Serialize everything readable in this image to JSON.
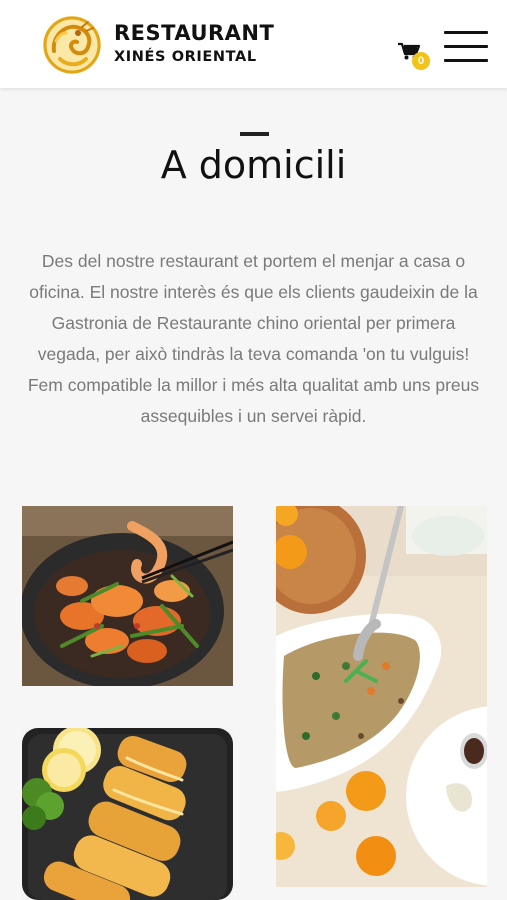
{
  "header": {
    "brand_line1": "RESTAURANT",
    "brand_line2": "XINÉS ORIENTAL",
    "logo_icon": "dragon-logo-icon",
    "cart_icon": "shopping-cart-icon",
    "cart_count": "0",
    "menu_icon": "hamburger-menu-icon"
  },
  "main": {
    "title": "A domicili",
    "intro": "Des del nostre restaurant et portem el menjar a casa o oficina. El nostre interès és que els clients gaudeixin de la Gastronia de Restaurante chino oriental per primera vegada, per això tindràs la teva comanda 'on tu vulguis! Fem compatible la millor i més alta qualitat amb uns preus assequibles i un servei ràpid.",
    "gallery": [
      {
        "subject": "shrimp-stir-fry-photo"
      },
      {
        "subject": "fried-rice-plate-photo"
      },
      {
        "subject": "lemon-chicken-photo"
      }
    ]
  },
  "colors": {
    "background": "#f6f6f6",
    "header_bg": "#ffffff",
    "badge": "#f2c318",
    "text": "#111111",
    "muted_text": "#7a7a7a"
  }
}
